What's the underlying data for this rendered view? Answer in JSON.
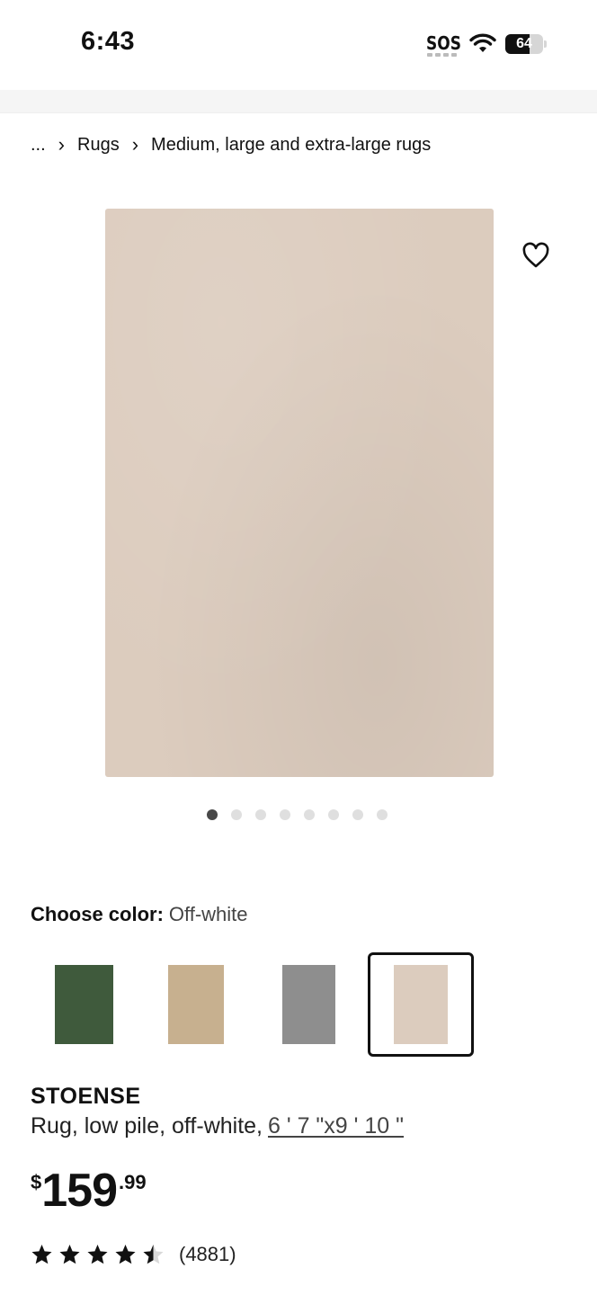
{
  "status_bar": {
    "time": "6:43",
    "sos": "SOS",
    "battery": "64",
    "battery_level": 0.64
  },
  "breadcrumb": {
    "ellipsis": "...",
    "items": [
      "Rugs",
      "Medium, large and extra-large rugs"
    ]
  },
  "gallery": {
    "image_count": 8,
    "active_index": 0,
    "favorite_icon": "heart-outline-icon"
  },
  "color_selector": {
    "label": "Choose color:",
    "selected": "Off-white",
    "swatches": [
      {
        "color": "#3f5a3c"
      },
      {
        "color": "#c7b08f"
      },
      {
        "color": "#8e8e8e"
      },
      {
        "color": "#dcccbe"
      }
    ],
    "selected_index": 3
  },
  "product": {
    "name": "STOENSE",
    "description": "Rug, low pile, off-white,",
    "size": "6 ' 7 \"x9 ' 10 \"",
    "price": {
      "currency": "$",
      "integer": "159",
      "decimal": ".99"
    },
    "rating": 4.5,
    "review_count": "(4881)"
  }
}
